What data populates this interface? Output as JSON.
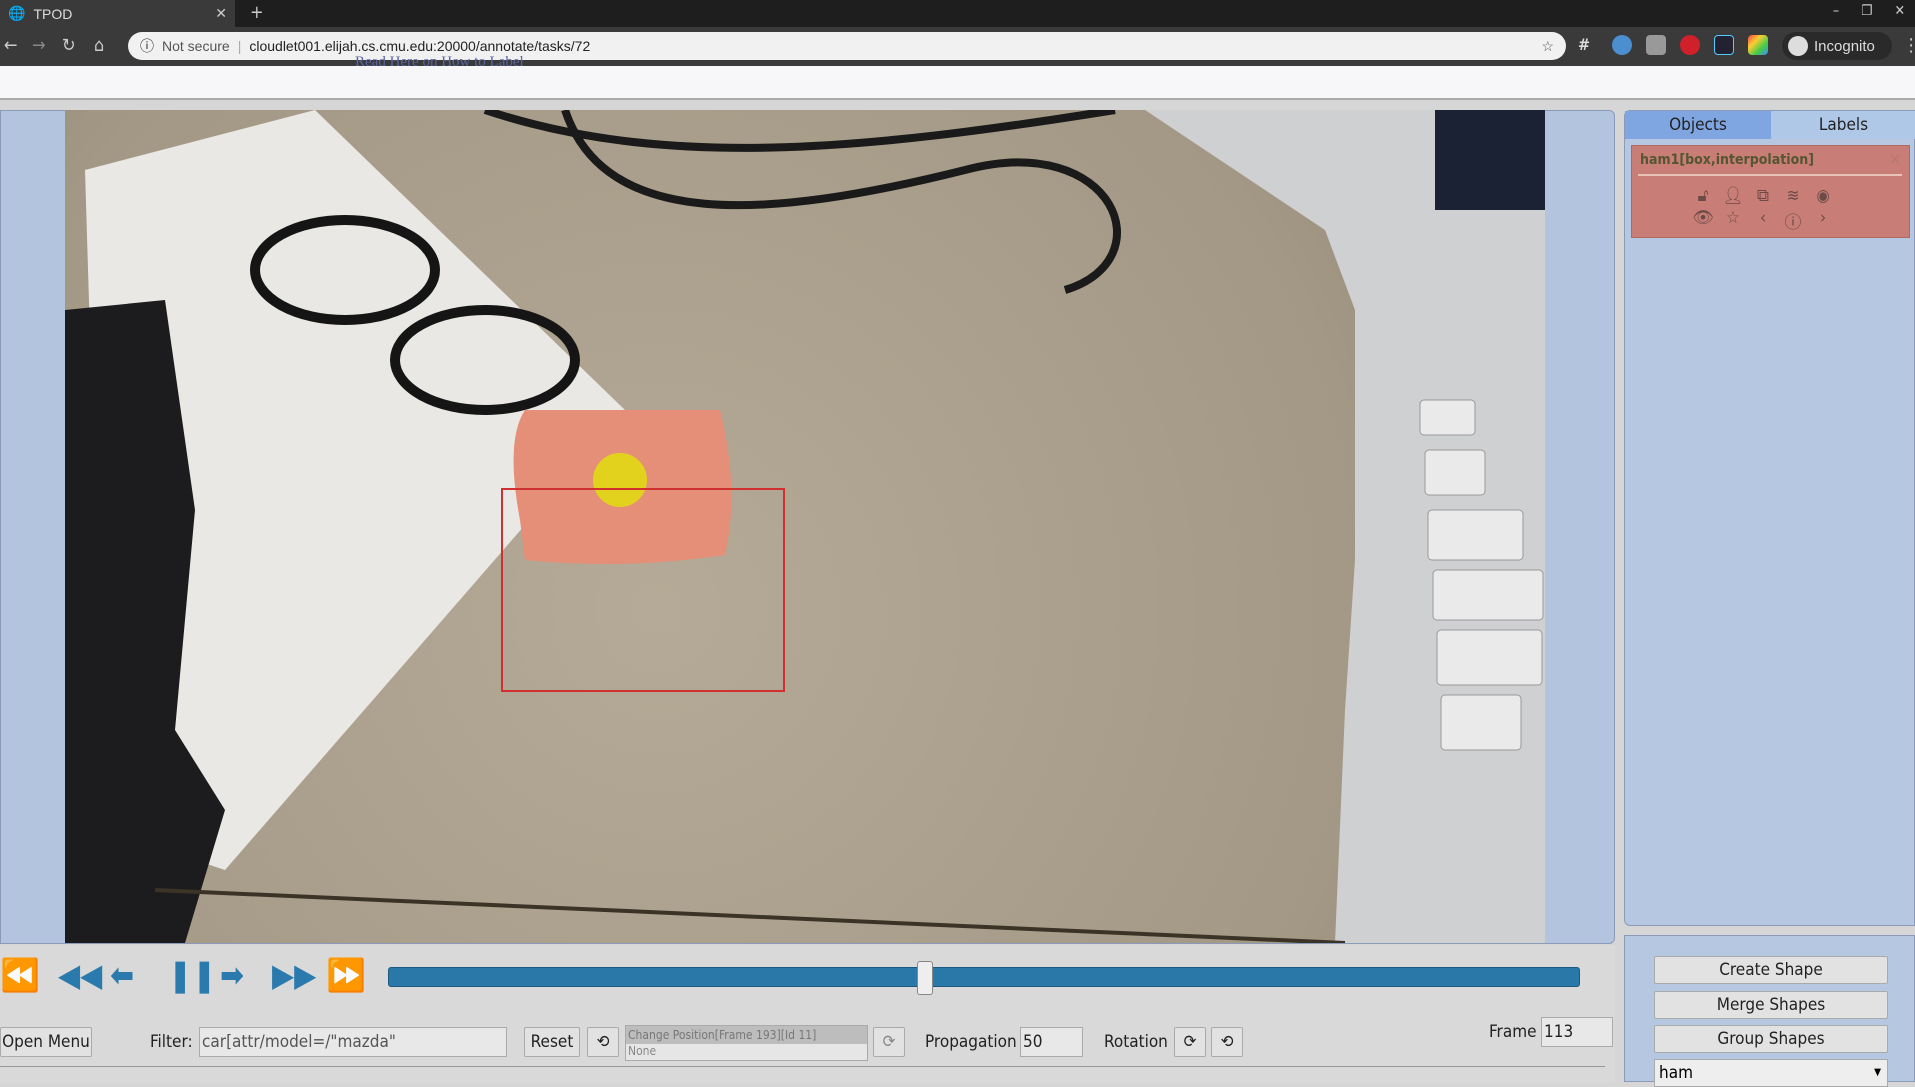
{
  "browser": {
    "tab_title": "TPOD",
    "url_security": "Not secure",
    "url": "cloudlet001.elijah.cs.cmu.edu:20000/annotate/tasks/72",
    "profile": "Incognito"
  },
  "page": {
    "help_link": "Read Here on How to Label"
  },
  "right_panel": {
    "tabs": [
      "Objects",
      "Labels"
    ],
    "active_tab": "Objects",
    "object": {
      "title": "ham1[box,interpolation]",
      "color": "#c87e77"
    },
    "buttons": {
      "create": "Create Shape",
      "merge": "Merge Shapes",
      "group": "Group Shapes"
    },
    "label_select": "ham"
  },
  "player": {
    "progress": 0.45,
    "accent": "#2a78a8",
    "open_menu": "Open Menu",
    "filter_label": "Filter:",
    "filter_value": "car[attr/model=/\"mazda\"",
    "reset": "Reset",
    "history_top": "Change Position[Frame 193][Id 11]",
    "history_bottom": "None",
    "propagation_label": "Propagation",
    "propagation_value": "50",
    "rotation_label": "Rotation",
    "frame_label": "Frame",
    "frame_value": "113"
  },
  "annotation": {
    "box_color": "#d03030"
  }
}
